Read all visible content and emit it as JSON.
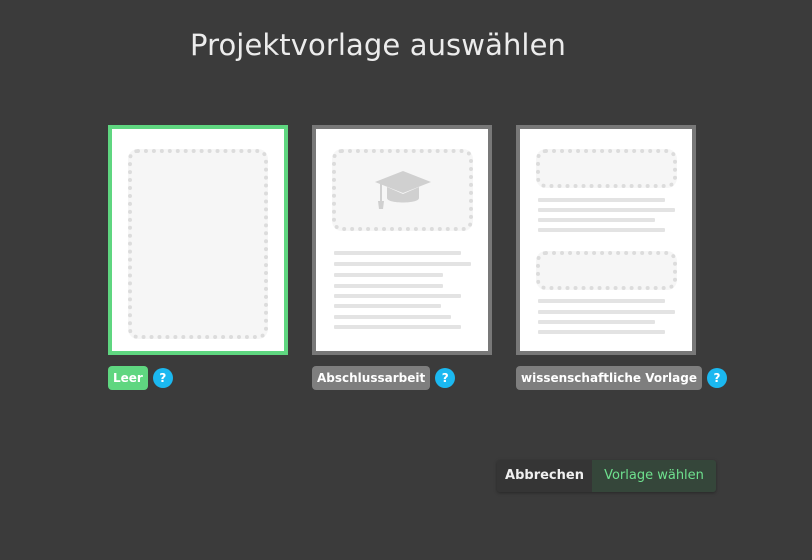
{
  "dialog": {
    "title": "Projektvorlage auswählen"
  },
  "templates": [
    {
      "label": "Leer",
      "help": "?",
      "selected": true
    },
    {
      "label": "Abschlussarbeit",
      "help": "?",
      "selected": false
    },
    {
      "label": "wissenschaftliche Vorlage",
      "help": "?",
      "selected": false
    }
  ],
  "footer": {
    "cancel_label": "Abbrechen",
    "confirm_label": "Vorlage wählen"
  },
  "colors": {
    "background": "#3b3b3b",
    "selected_accent": "#5fd680",
    "unselected_border": "#787878",
    "help_badge": "#1bb8f0"
  },
  "icons": {
    "thesis_preview": "graduation-cap-icon"
  }
}
